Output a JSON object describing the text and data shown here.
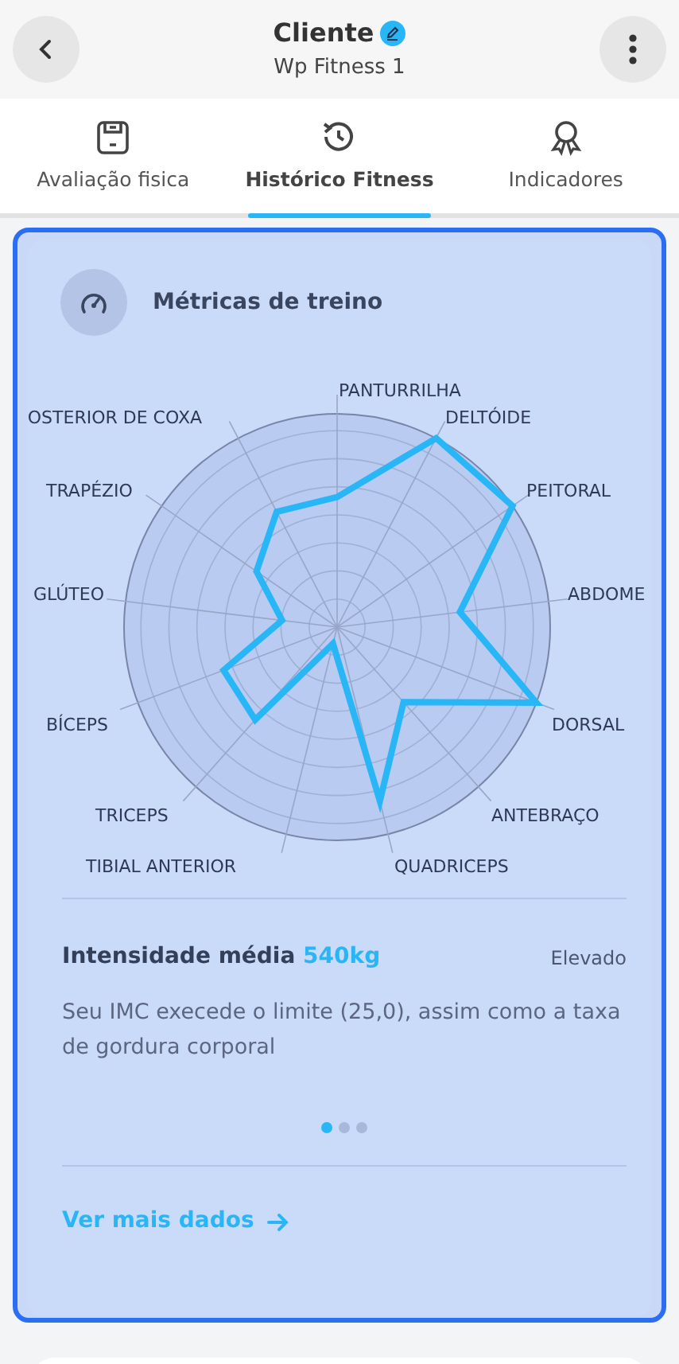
{
  "header": {
    "title": "Cliente",
    "subtitle": "Wp Fitness 1",
    "verified": true
  },
  "tabs": [
    {
      "label": "Avaliação fisica",
      "selected": false
    },
    {
      "label": "Histórico Fitness",
      "selected": true
    },
    {
      "label": "Indicadores",
      "selected": false
    }
  ],
  "card": {
    "title": "Métricas de treino",
    "radar_labels": [
      "PANTURRILHA",
      "OSTERIOR DE COXA",
      "DELTÓIDE",
      "TRAPÉZIO",
      "PEITORAL",
      "GLÚTEO",
      "ABDOME",
      "BÍCEPS",
      "DORSAL",
      "TRICEPS",
      "ANTEBRAÇO",
      "TIBIAL ANTERIOR",
      "QUADRICEPS"
    ],
    "metric_label": "Intensidade média",
    "metric_value": "540kg",
    "status": "Elevado",
    "description": "Seu IMC execede o limite (25,0), assim como a taxa de gordura corporal",
    "pages": [
      {
        "selected": true
      },
      {
        "selected": false
      },
      {
        "selected": false
      }
    ],
    "link": "Ver mais dados"
  }
}
